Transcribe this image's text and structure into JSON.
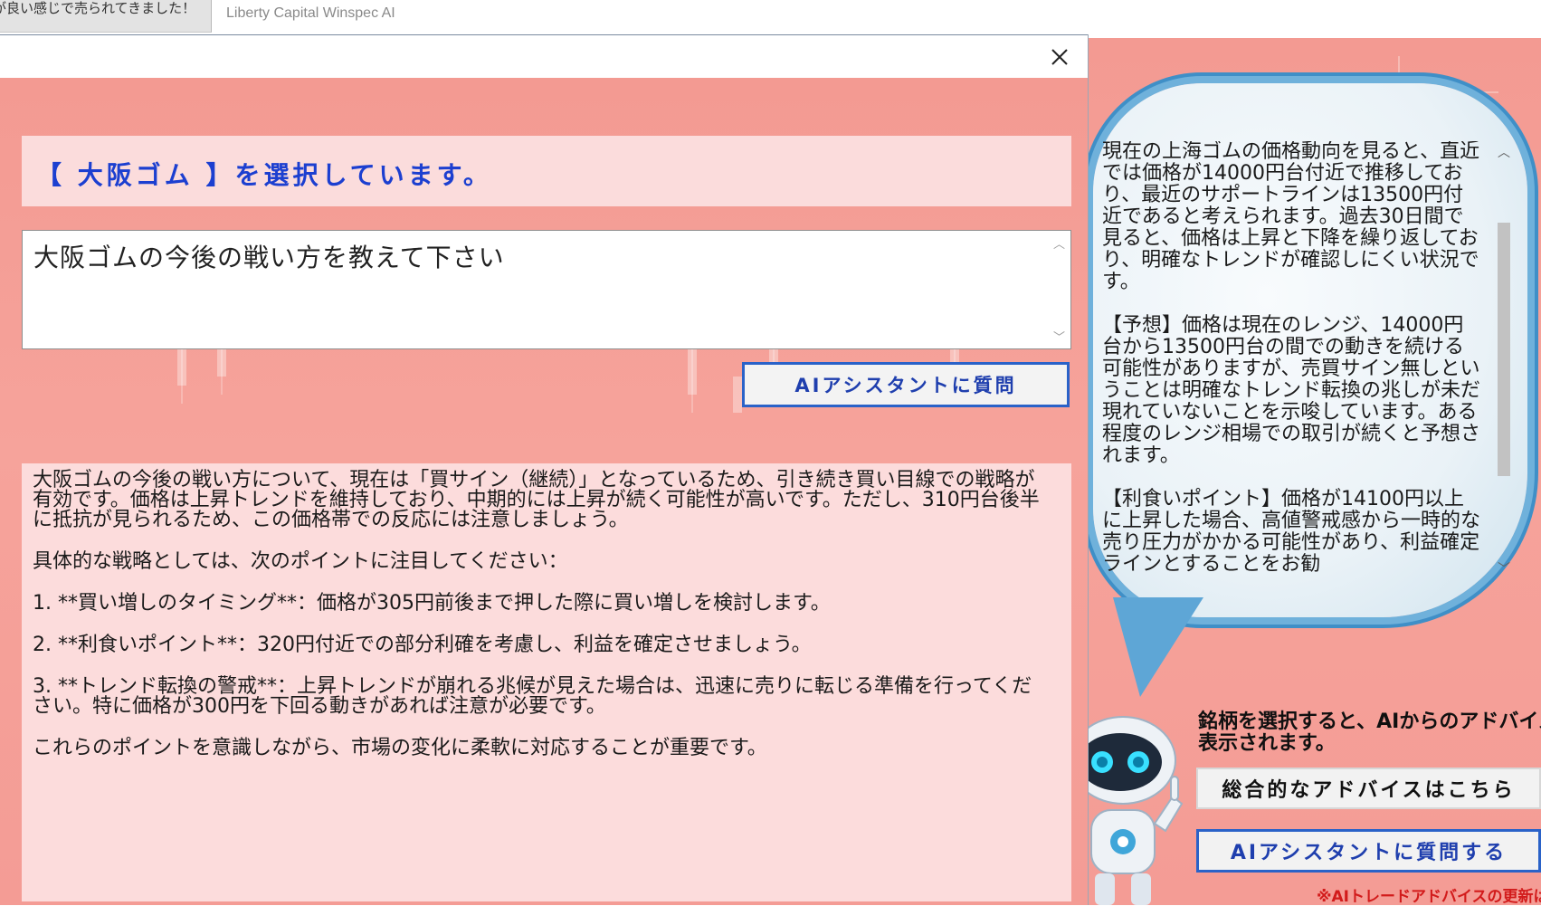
{
  "top_bar": {
    "tab_left_label": "が良い感じで売られてきました！",
    "app_title": "Liberty Capital Winspec AI"
  },
  "dialog": {
    "selected_label": "【 大阪ゴム 】を選択しています。",
    "question_text": "大阪ゴムの今後の戦い方を教えて下さい",
    "ask_button_label": "AIアシスタントに質問",
    "answer_paragraphs": [
      "大阪ゴムの今後の戦い方について、現在は「買サイン（継続）」となっているため、引き続き買い目線での戦略が有効です。価格は上昇トレンドを維持しており、中期的には上昇が続く可能性が高いです。ただし、310円台後半に抵抗が見られるため、この価格帯での反応には注意しましょう。",
      "具体的な戦略としては、次のポイントに注目してください：",
      "1. **買い増しのタイミング**：価格が305円前後まで押した際に買い増しを検討します。",
      "2. **利食いポイント**：320円付近での部分利確を考慮し、利益を確定させましょう。",
      "3. **トレンド転換の警戒**：上昇トレンドが崩れる兆候が見えた場合は、迅速に売りに転じる準備を行ってください。特に価格が300円を下回る動きがあれば注意が必要です。",
      "これらのポイントを意識しながら、市場の変化に柔軟に対応することが重要です。"
    ]
  },
  "right_panel": {
    "bubble_text": "現在の上海ゴムの価格動向を見ると、直近では価格が14000円台付近で推移しており、最近のサポートラインは13500円付近であると考えられます。過去30日間で見ると、価格は上昇と下降を繰り返しており、明確なトレンドが確認しにくい状況です。\n\n【予想】価格は現在のレンジ、14000円台から13500円台の間での動きを続ける可能性がありますが、売買サイン無しということは明確なトレンド転換の兆しが未だ現れていないことを示唆しています。ある程度のレンジ相場での取引が続くと予想されます。\n\n【利食いポイント】価格が14100円以上に上昇した場合、高値警戒感から一時的な売り圧力がかかる可能性があり、利益確定ラインとすることをお勧",
    "caption_line1": "銘柄を選択すると、AIからのアドバイス",
    "caption_line2": "表示されます。",
    "overall_advice_button": "総合的なアドバイスはこちら",
    "ask_ai_button": "AIアシスタントに質問する",
    "footnote": "※AIトレードアドバイスの更新は"
  },
  "colors": {
    "accent_blue": "#1c3fd0",
    "button_border_blue": "#2a62c8",
    "panel_pink": "#f49c95",
    "banner_pink": "#fbdcdc",
    "footnote_red": "#d21b1b",
    "bubble_border": "#5ea6d6"
  },
  "icons": {
    "close": "close-icon",
    "scroll_up": "scroll-up-arrow-icon",
    "scroll_down": "scroll-down-arrow-icon",
    "robot": "robot-mascot-icon"
  }
}
